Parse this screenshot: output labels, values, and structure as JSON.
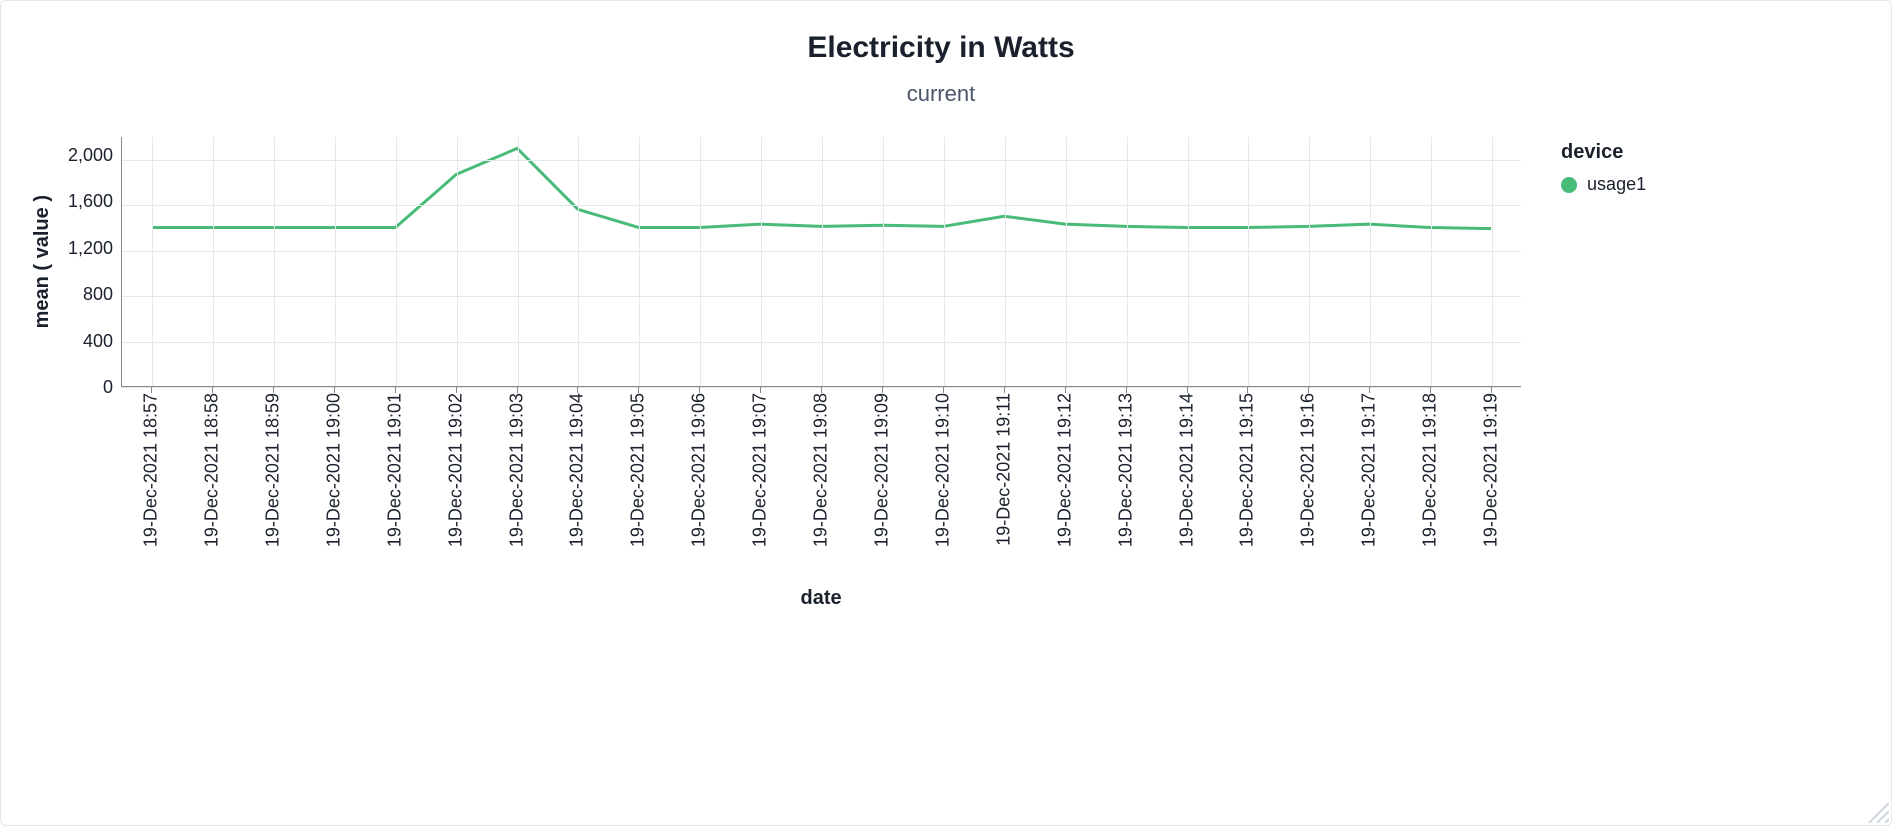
{
  "chart_data": {
    "type": "line",
    "title": "Electricity in Watts",
    "subtitle": "current",
    "xlabel": "date",
    "ylabel": "mean ( value )",
    "ylim": [
      0,
      2200
    ],
    "yticks": [
      2000,
      1600,
      1200,
      800,
      400,
      0
    ],
    "categories": [
      "19-Dec-2021 18:57",
      "19-Dec-2021 18:58",
      "19-Dec-2021 18:59",
      "19-Dec-2021 19:00",
      "19-Dec-2021 19:01",
      "19-Dec-2021 19:02",
      "19-Dec-2021 19:03",
      "19-Dec-2021 19:04",
      "19-Dec-2021 19:05",
      "19-Dec-2021 19:06",
      "19-Dec-2021 19:07",
      "19-Dec-2021 19:08",
      "19-Dec-2021 19:09",
      "19-Dec-2021 19:10",
      "19-Dec-2021 19:11",
      "19-Dec-2021 19:12",
      "19-Dec-2021 19:13",
      "19-Dec-2021 19:14",
      "19-Dec-2021 19:15",
      "19-Dec-2021 19:16",
      "19-Dec-2021 19:17",
      "19-Dec-2021 19:18",
      "19-Dec-2021 19:19"
    ],
    "series": [
      {
        "name": "usage1",
        "color": "#48bb78",
        "values": [
          1400,
          1400,
          1400,
          1400,
          1400,
          1870,
          2100,
          1560,
          1400,
          1400,
          1430,
          1410,
          1420,
          1410,
          1500,
          1430,
          1410,
          1400,
          1400,
          1410,
          1430,
          1400,
          1390
        ]
      }
    ],
    "legend_title": "device"
  }
}
